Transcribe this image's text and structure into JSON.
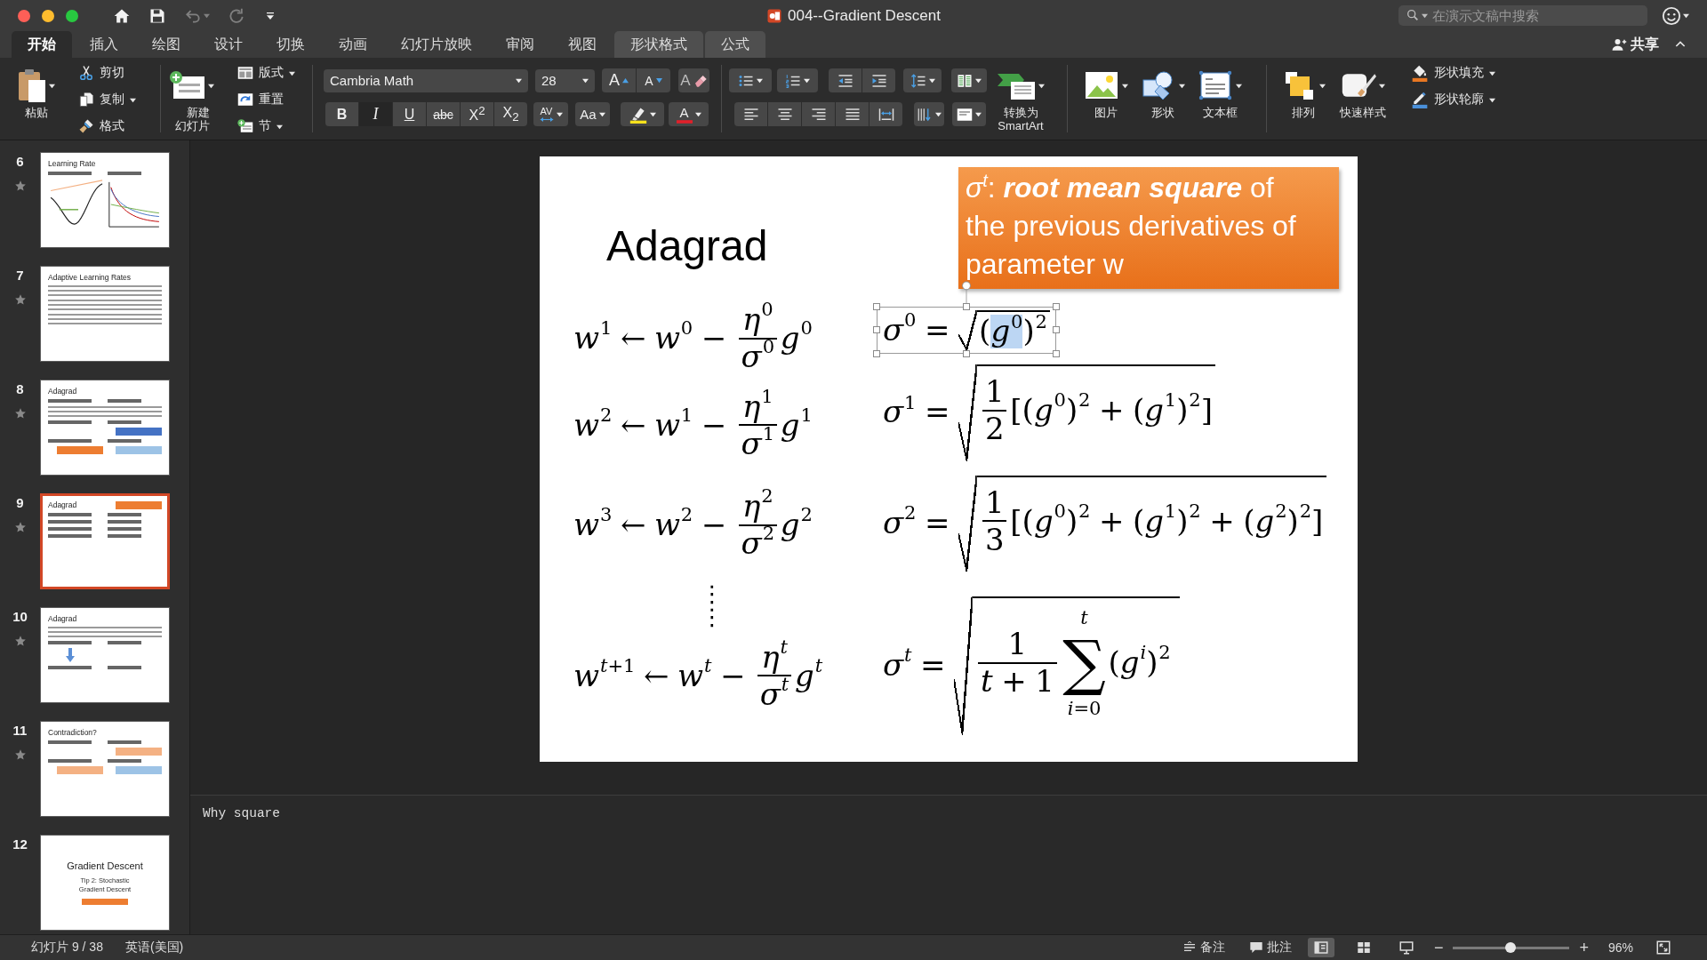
{
  "window": {
    "title": "004--Gradient Descent",
    "search_placeholder": "在演示文稿中搜索"
  },
  "quick_access": [
    {
      "kind": "home",
      "disabled": false
    },
    {
      "kind": "save",
      "disabled": false
    },
    {
      "kind": "undo",
      "disabled": true
    },
    {
      "kind": "redo",
      "disabled": true
    }
  ],
  "tabs": [
    {
      "label": "开始",
      "selected": true,
      "contextual": false
    },
    {
      "label": "插入",
      "selected": false,
      "contextual": false
    },
    {
      "label": "绘图",
      "selected": false,
      "contextual": false
    },
    {
      "label": "设计",
      "selected": false,
      "contextual": false
    },
    {
      "label": "切换",
      "selected": false,
      "contextual": false
    },
    {
      "label": "动画",
      "selected": false,
      "contextual": false
    },
    {
      "label": "幻灯片放映",
      "selected": false,
      "contextual": false
    },
    {
      "label": "审阅",
      "selected": false,
      "contextual": false
    },
    {
      "label": "视图",
      "selected": false,
      "contextual": false
    },
    {
      "label": "形状格式",
      "selected": false,
      "contextual": true
    },
    {
      "label": "公式",
      "selected": false,
      "contextual": true
    }
  ],
  "share": "共享",
  "ribbon": {
    "clipboard": {
      "paste": "粘贴",
      "tools": [
        {
          "kind": "cut",
          "label": "剪切",
          "dropdown": false
        },
        {
          "kind": "copy",
          "label": "复制",
          "dropdown": true
        },
        {
          "kind": "brush",
          "label": "格式",
          "dropdown": false
        }
      ]
    },
    "slides": {
      "new_slide": "新建幻灯片",
      "tools": [
        {
          "kind": "layout",
          "label": "版式",
          "dropdown": true
        },
        {
          "kind": "reset",
          "label": "重置",
          "dropdown": false
        },
        {
          "kind": "section",
          "label": "节",
          "dropdown": true
        }
      ]
    },
    "font": {
      "name": "Cambria Math",
      "size": "28",
      "grow": "A",
      "shrink": "A",
      "clear": "A",
      "styles": [
        {
          "kind": "bold",
          "label": "B",
          "on": false
        },
        {
          "kind": "italic",
          "label": "I",
          "on": true
        },
        {
          "kind": "underline",
          "label": "U",
          "on": false
        },
        {
          "kind": "strike",
          "label": "abc",
          "on": false
        },
        {
          "kind": "sup",
          "label": "X$^{2}$",
          "on": false
        },
        {
          "kind": "sub",
          "label": "X$_{2}$",
          "on": false
        }
      ],
      "spacing": "AV",
      "case": "Aa",
      "tint_letter": "A"
    },
    "paragraph": {
      "smartart": "转换为SmartArt"
    },
    "insert": [
      {
        "kind": "picture",
        "label": "图片"
      },
      {
        "kind": "shape",
        "label": "形状"
      },
      {
        "kind": "textbox",
        "label": "文本框"
      }
    ],
    "arrange": [
      {
        "kind": "arrange",
        "label": "排列"
      },
      {
        "kind": "styles",
        "label": "快速样式"
      }
    ],
    "shape": [
      {
        "kind": "fill",
        "label": "形状填充"
      },
      {
        "kind": "outline",
        "label": "形状轮廓"
      }
    ]
  },
  "slides_pane": [
    {
      "number": "6",
      "transition": true,
      "selected": false,
      "kind": "content",
      "title": "Learning Rate",
      "items": [
        {
          "kind": "formula"
        },
        {
          "kind": "plot"
        }
      ]
    },
    {
      "number": "7",
      "transition": true,
      "selected": false,
      "kind": "content",
      "title": "Adaptive Learning Rates",
      "items": [
        {
          "kind": "lines"
        },
        {
          "kind": "lines"
        },
        {
          "kind": "lines"
        }
      ]
    },
    {
      "number": "8",
      "transition": true,
      "selected": false,
      "kind": "content",
      "title": "Adagrad",
      "items": [
        {
          "kind": "formula"
        },
        {
          "kind": "lines"
        },
        {
          "kind": "formula"
        },
        {
          "kind": "box",
          "color": "#4472c4"
        },
        {
          "kind": "formula"
        },
        {
          "kind": "box",
          "color": "#ed7d31"
        },
        {
          "kind": "box",
          "color": "#9dc3e6"
        }
      ]
    },
    {
      "number": "9",
      "transition": true,
      "selected": true,
      "kind": "content",
      "title": "Adagrad",
      "items": [
        {
          "kind": "box",
          "color": "#ed7d31"
        },
        {
          "kind": "formula"
        },
        {
          "kind": "formula"
        },
        {
          "kind": "formula"
        },
        {
          "kind": "formula"
        }
      ]
    },
    {
      "number": "10",
      "transition": true,
      "selected": false,
      "kind": "content",
      "title": "Adagrad",
      "items": [
        {
          "kind": "lines"
        },
        {
          "kind": "formula"
        },
        {
          "kind": "arrow"
        },
        {
          "kind": "formula"
        }
      ]
    },
    {
      "number": "11",
      "transition": true,
      "selected": false,
      "kind": "content",
      "title": "Contradiction?",
      "items": [
        {
          "kind": "formula"
        },
        {
          "kind": "box",
          "color": "#f4b183"
        },
        {
          "kind": "formula"
        },
        {
          "kind": "box",
          "color": "#f4b183"
        },
        {
          "kind": "box",
          "color": "#9dc3e6"
        }
      ]
    },
    {
      "number": "12",
      "transition": false,
      "selected": false,
      "kind": "section",
      "title": "Gradient Descent",
      "subtitle": "Tip 2: Stochastic Gradient Descent",
      "items": [
        {
          "kind": "box",
          "color": "#ed7d31"
        }
      ]
    }
  ],
  "slide": {
    "title": "Adagrad",
    "callout": "*σ*$^{t}$: **root mean square** of the previous derivatives of parameter w",
    "left_column": [
      {
        "kind": "formula",
        "tokens": [
          {
            "kind": "var",
            "base": "w",
            "sup": "1"
          },
          {
            "kind": "op",
            "s": "←"
          },
          {
            "kind": "var",
            "base": "w",
            "sup": "0"
          },
          {
            "kind": "op",
            "s": "−"
          },
          {
            "kind": "frac",
            "num": [
              {
                "kind": "var",
                "base": "η",
                "sup": "0"
              }
            ],
            "den": [
              {
                "kind": "var",
                "base": "σ",
                "sup": "0"
              }
            ]
          },
          {
            "kind": "var",
            "base": "g",
            "sup": "0"
          }
        ]
      },
      {
        "kind": "formula",
        "tokens": [
          {
            "kind": "var",
            "base": "w",
            "sup": "2"
          },
          {
            "kind": "op",
            "s": "←"
          },
          {
            "kind": "var",
            "base": "w",
            "sup": "1"
          },
          {
            "kind": "op",
            "s": "−"
          },
          {
            "kind": "frac",
            "num": [
              {
                "kind": "var",
                "base": "η",
                "sup": "1"
              }
            ],
            "den": [
              {
                "kind": "var",
                "base": "σ",
                "sup": "1"
              }
            ]
          },
          {
            "kind": "var",
            "base": "g",
            "sup": "1"
          }
        ]
      },
      {
        "kind": "formula",
        "tokens": [
          {
            "kind": "var",
            "base": "w",
            "sup": "3"
          },
          {
            "kind": "op",
            "s": "←"
          },
          {
            "kind": "var",
            "base": "w",
            "sup": "2"
          },
          {
            "kind": "op",
            "s": "−"
          },
          {
            "kind": "frac",
            "num": [
              {
                "kind": "var",
                "base": "η",
                "sup": "2"
              }
            ],
            "den": [
              {
                "kind": "var",
                "base": "σ",
                "sup": "2"
              }
            ]
          },
          {
            "kind": "var",
            "base": "g",
            "sup": "2"
          }
        ]
      },
      {
        "kind": "ellipsis",
        "text": "⋮⋮"
      },
      {
        "kind": "formula",
        "tokens": [
          {
            "kind": "var",
            "base": "w",
            "sup": "*t*+1"
          },
          {
            "kind": "op",
            "s": "←"
          },
          {
            "kind": "var",
            "base": "w",
            "sup": "*t*"
          },
          {
            "kind": "op",
            "s": "−"
          },
          {
            "kind": "frac",
            "num": [
              {
                "kind": "var",
                "base": "η",
                "sup": "*t*"
              }
            ],
            "den": [
              {
                "kind": "var",
                "base": "σ",
                "sup": "*t*"
              }
            ]
          },
          {
            "kind": "var",
            "base": "g",
            "sup": "*t*"
          }
        ]
      }
    ],
    "right_column": [
      {
        "selected": true,
        "tokens": [
          {
            "kind": "var",
            "base": "σ",
            "sup": "0"
          },
          {
            "kind": "op",
            "s": "="
          },
          {
            "kind": "sqrt",
            "body": [
              {
                "kind": "sym",
                "s": "(",
                "highlighted": false
              },
              {
                "kind": "var",
                "base": "g",
                "sup": "0",
                "highlighted": true
              },
              {
                "kind": "sym",
                "s": ")",
                "sup": "2",
                "highlighted": false
              }
            ]
          }
        ]
      },
      {
        "selected": false,
        "tokens": [
          {
            "kind": "var",
            "base": "σ",
            "sup": "1"
          },
          {
            "kind": "op",
            "s": "="
          },
          {
            "kind": "sqrt",
            "body": [
              {
                "kind": "frac",
                "num": [
                  {
                    "kind": "sym",
                    "s": "1"
                  }
                ],
                "den": [
                  {
                    "kind": "sym",
                    "s": "2"
                  }
                ]
              },
              {
                "kind": "sym",
                "s": "[("
              },
              {
                "kind": "var",
                "base": "g",
                "sup": "0"
              },
              {
                "kind": "sym",
                "s": ")",
                "sup": "2"
              },
              {
                "kind": "op",
                "s": "+"
              },
              {
                "kind": "sym",
                "s": "("
              },
              {
                "kind": "var",
                "base": "g",
                "sup": "1"
              },
              {
                "kind": "sym",
                "s": ")",
                "sup": "2"
              },
              {
                "kind": "sym",
                "s": "]"
              }
            ]
          }
        ]
      },
      {
        "selected": false,
        "tokens": [
          {
            "kind": "var",
            "base": "σ",
            "sup": "2"
          },
          {
            "kind": "op",
            "s": "="
          },
          {
            "kind": "sqrt",
            "body": [
              {
                "kind": "frac",
                "num": [
                  {
                    "kind": "sym",
                    "s": "1"
                  }
                ],
                "den": [
                  {
                    "kind": "sym",
                    "s": "3"
                  }
                ]
              },
              {
                "kind": "sym",
                "s": "[("
              },
              {
                "kind": "var",
                "base": "g",
                "sup": "0"
              },
              {
                "kind": "sym",
                "s": ")",
                "sup": "2"
              },
              {
                "kind": "op",
                "s": "+"
              },
              {
                "kind": "sym",
                "s": "("
              },
              {
                "kind": "var",
                "base": "g",
                "sup": "1"
              },
              {
                "kind": "sym",
                "s": ")",
                "sup": "2"
              },
              {
                "kind": "op",
                "s": "+"
              },
              {
                "kind": "sym",
                "s": "("
              },
              {
                "kind": "var",
                "base": "g",
                "sup": "2"
              },
              {
                "kind": "sym",
                "s": ")",
                "sup": "2"
              },
              {
                "kind": "sym",
                "s": "]"
              }
            ]
          }
        ]
      },
      {
        "selected": false,
        "tokens": [
          {
            "kind": "var",
            "base": "σ",
            "sup": "*t*"
          },
          {
            "kind": "op",
            "s": "="
          },
          {
            "kind": "sqrt",
            "body": [
              {
                "kind": "frac",
                "num": [
                  {
                    "kind": "sym",
                    "s": "1"
                  }
                ],
                "den": [
                  {
                    "kind": "var",
                    "base": "t"
                  },
                  {
                    "kind": "op",
                    "s": "+"
                  },
                  {
                    "kind": "sym",
                    "s": "1"
                  }
                ]
              },
              {
                "kind": "sum",
                "symbol": "∑",
                "upper": "*t*",
                "lower": "*i*=0"
              },
              {
                "kind": "sym",
                "s": "("
              },
              {
                "kind": "var",
                "base": "g",
                "sup": "*i*"
              },
              {
                "kind": "sym",
                "s": ")",
                "sup": "2"
              }
            ]
          }
        ]
      }
    ]
  },
  "notes": {
    "text": "Why square"
  },
  "status": {
    "slide": "幻灯片 9 / 38",
    "language": "英语(美国)",
    "notes": "备注",
    "comments": "批注",
    "views": [
      {
        "kind": "normal",
        "selected": true
      },
      {
        "kind": "sorter",
        "selected": false
      },
      {
        "kind": "reading",
        "selected": false
      }
    ],
    "zoom_out": "−",
    "zoom_in": "+",
    "zoom": {
      "level": 0.49
    },
    "zoom_reading": "96%"
  }
}
